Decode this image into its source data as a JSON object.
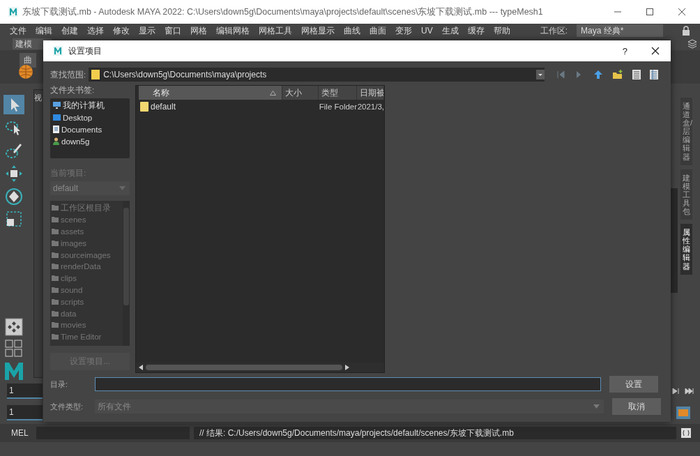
{
  "window": {
    "title": "东坡下载测试.mb - Autodesk MAYA 2022: C:\\Users\\down5g\\Documents\\maya\\projects\\default\\scenes\\东坡下载测试.mb  ---  typeMesh1"
  },
  "menu": [
    "文件",
    "编辑",
    "创建",
    "选择",
    "修改",
    "显示",
    "窗口",
    "网格",
    "编辑网格",
    "网格工具",
    "网格显示",
    "曲线",
    "曲面",
    "变形",
    "UV",
    "生成",
    "缓存",
    "帮助"
  ],
  "workspace": {
    "label": "工作区:",
    "value": "Maya 经典*"
  },
  "mode_menu": {
    "value": "建模"
  },
  "shelf_tab": "曲",
  "viewport_tab": "视",
  "side_tabs": [
    {
      "label": "通道盒/层编辑器",
      "selected": false
    },
    {
      "label": "建模工具包",
      "selected": false
    },
    {
      "label": "属性编辑器",
      "selected": true
    }
  ],
  "timeline": {
    "current": "1",
    "range_start": "1"
  },
  "command_line": {
    "label": "MEL",
    "result": "// 结果: C:/Users/down5g/Documents/maya/projects/default/scenes/东坡下载测试.mb"
  },
  "dialog": {
    "title": "设置项目",
    "help": "?",
    "look_in": {
      "label": "查找范围:",
      "path": "C:\\Users\\down5g\\Documents\\maya\\projects"
    },
    "bookmarks": {
      "label": "文件夹书签:",
      "items": [
        {
          "name": "我的计算机",
          "kind": "computer"
        },
        {
          "name": "Desktop",
          "kind": "desktop"
        },
        {
          "name": "Documents",
          "kind": "documents"
        },
        {
          "name": "down5g",
          "kind": "user"
        }
      ]
    },
    "current_project": {
      "label": "当前项目:",
      "value": "default",
      "disabled": true
    },
    "project_folders": [
      "工作区根目录",
      "scenes",
      "assets",
      "images",
      "sourceimages",
      "renderData",
      "clips",
      "sound",
      "scripts",
      "data",
      "movies",
      "Time Editor"
    ],
    "set_project_button": {
      "label": "设置项目...",
      "disabled": true
    },
    "columns": [
      {
        "label": "名称",
        "sorted": true
      },
      {
        "label": "大小",
        "sorted": false
      },
      {
        "label": "类型",
        "sorted": false
      },
      {
        "label": "日期被",
        "sorted": false
      }
    ],
    "files": [
      {
        "name": "default",
        "type": "File Folder",
        "date": "2021/3,"
      }
    ],
    "directory": {
      "label": "目录:",
      "focused": true
    },
    "file_type": {
      "label": "文件类型:",
      "value": "所有文件",
      "disabled": true
    },
    "buttons": [
      "设置",
      "取消"
    ]
  }
}
